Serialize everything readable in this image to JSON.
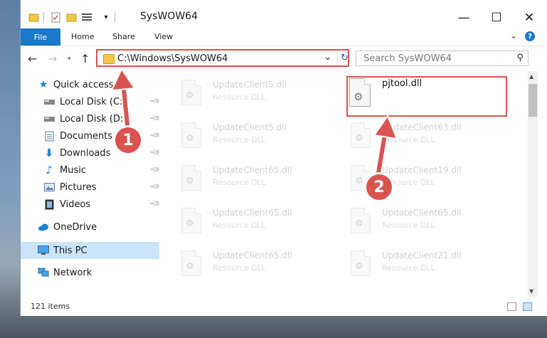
{
  "window": {
    "title": "SysWOW64",
    "controls": {
      "minimize": "—",
      "maximize": "☐",
      "close": "✕"
    }
  },
  "ribbon": {
    "tabs": [
      "File",
      "Home",
      "Share",
      "View"
    ]
  },
  "address": {
    "path": "C:\\Windows\\SysWOW64",
    "search_placeholder": "Search SysWOW64"
  },
  "sidebar": {
    "items": [
      {
        "label": "Quick access",
        "icon": "star-icon",
        "pinned": false
      },
      {
        "label": "Local Disk (C:)",
        "icon": "drive-icon",
        "pinned": true
      },
      {
        "label": "Local Disk (D:)",
        "icon": "drive-icon",
        "pinned": true
      },
      {
        "label": "Documents",
        "icon": "documents-icon",
        "pinned": true
      },
      {
        "label": "Downloads",
        "icon": "download-icon",
        "pinned": true
      },
      {
        "label": "Music",
        "icon": "music-icon",
        "pinned": true
      },
      {
        "label": "Pictures",
        "icon": "pictures-icon",
        "pinned": true
      },
      {
        "label": "Videos",
        "icon": "videos-icon",
        "pinned": true
      },
      {
        "label": "OneDrive",
        "icon": "cloud-icon",
        "pinned": false
      },
      {
        "label": "This PC",
        "icon": "monitor-icon",
        "pinned": false,
        "selected": true
      },
      {
        "label": "Network",
        "icon": "network-icon",
        "pinned": false
      }
    ]
  },
  "files": {
    "left": [
      {
        "name": "UpdateClient5.dll",
        "type": "Resource DLL"
      },
      {
        "name": "UpdateClient5.dll",
        "type": "Resource DLL"
      },
      {
        "name": "UpdateClient65.dll",
        "type": "Resource DLL"
      },
      {
        "name": "UpdateClient65.dll",
        "type": "Resource DLL"
      },
      {
        "name": "UpdateClient65.dll",
        "type": "Resource DLL"
      }
    ],
    "right": [
      {
        "name": "pjtool.dll",
        "type": "",
        "highlighted": true
      },
      {
        "name": "UpdateClient63.dll",
        "type": "Resource DLL"
      },
      {
        "name": "UpdateClient19.dll",
        "type": "Resource DLL"
      },
      {
        "name": "UpdateClient65.dll",
        "type": "Resource DLL"
      },
      {
        "name": "UpdateClient21.dll",
        "type": "Resource DLL"
      }
    ]
  },
  "status": {
    "item_count": "121 items"
  },
  "annotations": {
    "step1": "1",
    "step2": "2",
    "accent_color": "#d9534f"
  }
}
